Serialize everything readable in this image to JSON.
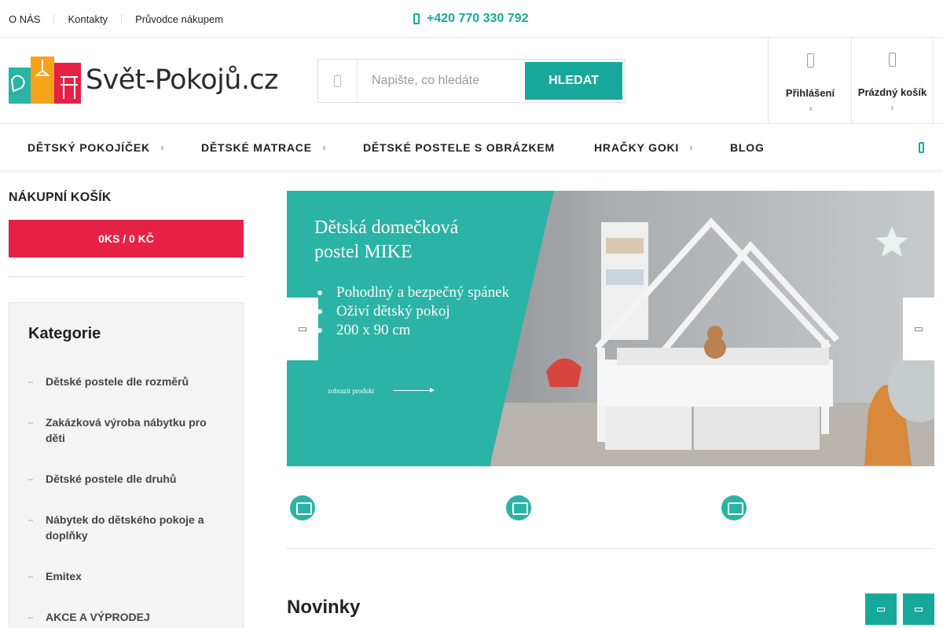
{
  "topbar": {
    "links": [
      "O NÁS",
      "Kontakty",
      "Průvodce nákupem"
    ],
    "phone": "+420 770 330 792"
  },
  "header": {
    "logo_text": "Svět-Pokojů.cz",
    "search_placeholder": "Napište, co hledáte",
    "search_button": "HLEDAT",
    "login_label": "Přihlášení",
    "cart_label": "Prázdný košík"
  },
  "nav": {
    "items": [
      "DĚTSKÝ POKOJÍČEK",
      "DĚTSKÉ MATRACE",
      "DĚTSKÉ POSTELE S OBRÁZKEM",
      "HRAČKY GOKI",
      "BLOG"
    ]
  },
  "sidebar": {
    "cart_title": "NÁKUPNÍ KOŠÍK",
    "cart_summary": "0KS / 0 KČ",
    "categories_title": "Kategorie",
    "categories": [
      "Dětské postele dle rozměrů",
      "Zakázková výroba nábytku pro děti",
      "Dětské postele dle druhů",
      "Nábytek do dětského pokoje a doplňky",
      "Emitex",
      "AKCE A VÝPRODEJ"
    ]
  },
  "banner": {
    "title": "Dětská domečková postel MIKE",
    "bullets": [
      "Pohodlný a bezpečný spánek",
      "Oživí dětský pokoj",
      "200 x 90 cm"
    ],
    "link": "zobrazit produkt",
    "accent_color": "#2bb3a5"
  },
  "main": {
    "section_title": "Novinky"
  },
  "colors": {
    "brand": "#18a89b",
    "cart": "#e62145"
  },
  "icons": [
    "phone-icon",
    "search-icon",
    "user-icon",
    "cart-icon",
    "chevron-left-icon",
    "chevron-right-icon"
  ]
}
